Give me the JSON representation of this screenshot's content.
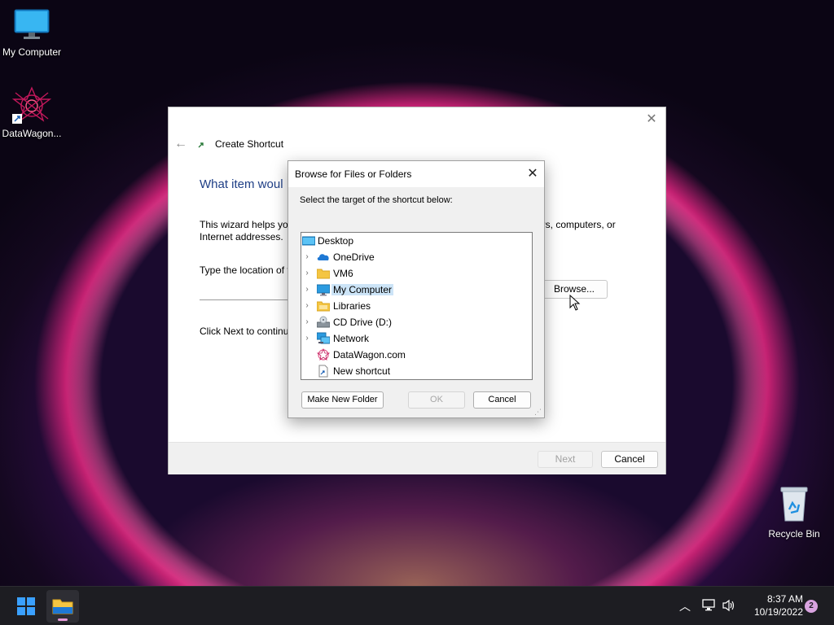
{
  "desktop": {
    "icons": [
      {
        "label": "My Computer",
        "icon": "monitor-icon"
      },
      {
        "label": "DataWagon...",
        "icon": "datawagon-logo-icon"
      },
      {
        "label": "Recycle Bin",
        "icon": "recycle-bin-icon"
      }
    ]
  },
  "wizard": {
    "title": "Create Shortcut",
    "heading": "What item woul",
    "desc_line1": "This wizard helps you",
    "desc_line2": "Internet addresses.",
    "desc_right": "ers, computers, or",
    "location_label": "Type the location of t",
    "location_value": "",
    "browse_label": "Browse...",
    "click_next": "Click Next to continu",
    "next_label": "Next",
    "cancel_label": "Cancel"
  },
  "browse_dialog": {
    "title": "Browse for Files or Folders",
    "instruction": "Select the target of the shortcut below:",
    "tree": [
      {
        "label": "Desktop",
        "icon": "desktop-icon",
        "expandable": false,
        "selected": false
      },
      {
        "label": "OneDrive",
        "icon": "onedrive-icon",
        "expandable": true,
        "selected": false
      },
      {
        "label": "VM6",
        "icon": "folder-icon",
        "expandable": true,
        "selected": false
      },
      {
        "label": "My Computer",
        "icon": "monitor-icon",
        "expandable": true,
        "selected": true
      },
      {
        "label": "Libraries",
        "icon": "libraries-icon",
        "expandable": true,
        "selected": false
      },
      {
        "label": "CD Drive (D:)",
        "icon": "cd-drive-icon",
        "expandable": true,
        "selected": false
      },
      {
        "label": "Network",
        "icon": "network-icon",
        "expandable": true,
        "selected": false
      },
      {
        "label": "DataWagon.com",
        "icon": "datawagon-logo-icon",
        "expandable": false,
        "selected": false
      },
      {
        "label": "New shortcut",
        "icon": "shortcut-file-icon",
        "expandable": false,
        "selected": false
      }
    ],
    "make_folder_label": "Make New Folder",
    "ok_label": "OK",
    "cancel_label": "Cancel"
  },
  "taskbar": {
    "time": "8:37 AM",
    "date": "10/19/2022",
    "notification_count": "2"
  },
  "colors": {
    "accent": "#0067c0",
    "wizard_heading": "#1f3f86",
    "selection": "#cce4f7",
    "taskbar": "#1d1d22"
  }
}
